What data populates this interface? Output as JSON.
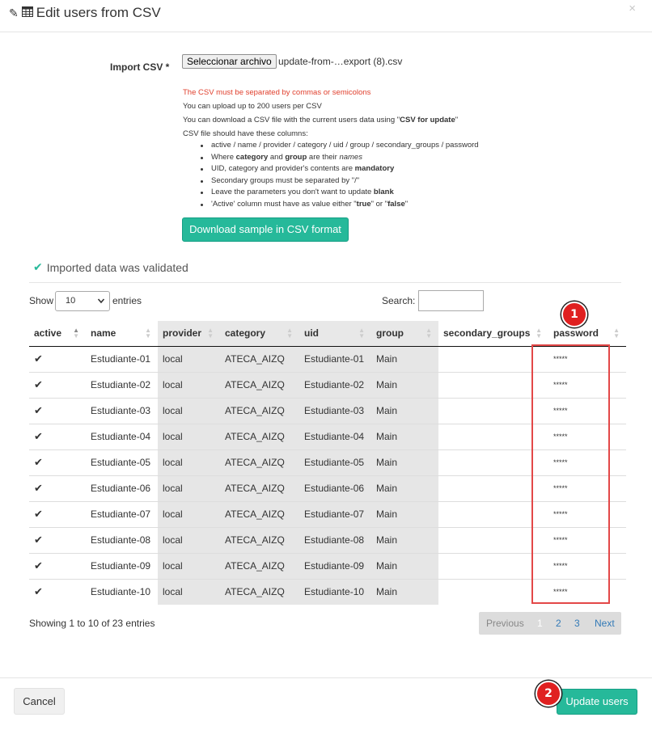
{
  "header": {
    "title": "Edit users from CSV",
    "title_icons": [
      "pencil-icon",
      "table-icon"
    ],
    "close_label": "×"
  },
  "import": {
    "label": "Import CSV *",
    "file_button": "Seleccionar archivo",
    "file_name": "update-from-…export (8).csv",
    "warning": "The CSV must be separated by commas or semicolons",
    "limit": "You can upload up to 200 users per CSV",
    "download_prefix": "You can download a CSV file with the current users data using \"",
    "download_strong": "CSV for update",
    "download_suffix": "\"",
    "columns_intro": "CSV file should have these columns:",
    "bullets": {
      "b1": "active / name / provider / category / uid / group / secondary_groups / password",
      "b2_pre": "Where ",
      "b2_s1": "category",
      "b2_mid": " and ",
      "b2_s2": "group",
      "b2_mid2": " are their ",
      "b2_em": "names",
      "b3_pre": "UID, category and provider's contents are ",
      "b3_strong": "mandatory",
      "b4": "Secondary groups must be separated by \"/\"",
      "b5_pre": "Leave the parameters you don't want to update ",
      "b5_strong": "blank",
      "b6_pre": "'Active' column must have as value either \"",
      "b6_s1": "true",
      "b6_mid": "\" or \"",
      "b6_s2": "false",
      "b6_suf": "\""
    },
    "sample_button": "Download sample in CSV format"
  },
  "validation": {
    "message": "Imported data was validated"
  },
  "table_controls": {
    "show_label": "Show",
    "page_size": "10",
    "entries_label": "entries",
    "search_label": "Search:",
    "search_value": ""
  },
  "table": {
    "headers": {
      "active": "active",
      "name": "name",
      "provider": "provider",
      "category": "category",
      "uid": "uid",
      "group": "group",
      "secondary_groups": "secondary_groups",
      "password": "password"
    },
    "check_glyph": "✔",
    "rows": [
      {
        "name": "Estudiante-01",
        "provider": "local",
        "category": "ATECA_AIZQ",
        "uid": "Estudiante-01",
        "group": "Main",
        "secondary_groups": "",
        "password": "*****"
      },
      {
        "name": "Estudiante-02",
        "provider": "local",
        "category": "ATECA_AIZQ",
        "uid": "Estudiante-02",
        "group": "Main",
        "secondary_groups": "",
        "password": "*****"
      },
      {
        "name": "Estudiante-03",
        "provider": "local",
        "category": "ATECA_AIZQ",
        "uid": "Estudiante-03",
        "group": "Main",
        "secondary_groups": "",
        "password": "*****"
      },
      {
        "name": "Estudiante-04",
        "provider": "local",
        "category": "ATECA_AIZQ",
        "uid": "Estudiante-04",
        "group": "Main",
        "secondary_groups": "",
        "password": "*****"
      },
      {
        "name": "Estudiante-05",
        "provider": "local",
        "category": "ATECA_AIZQ",
        "uid": "Estudiante-05",
        "group": "Main",
        "secondary_groups": "",
        "password": "*****"
      },
      {
        "name": "Estudiante-06",
        "provider": "local",
        "category": "ATECA_AIZQ",
        "uid": "Estudiante-06",
        "group": "Main",
        "secondary_groups": "",
        "password": "*****"
      },
      {
        "name": "Estudiante-07",
        "provider": "local",
        "category": "ATECA_AIZQ",
        "uid": "Estudiante-07",
        "group": "Main",
        "secondary_groups": "",
        "password": "*****"
      },
      {
        "name": "Estudiante-08",
        "provider": "local",
        "category": "ATECA_AIZQ",
        "uid": "Estudiante-08",
        "group": "Main",
        "secondary_groups": "",
        "password": "*****"
      },
      {
        "name": "Estudiante-09",
        "provider": "local",
        "category": "ATECA_AIZQ",
        "uid": "Estudiante-09",
        "group": "Main",
        "secondary_groups": "",
        "password": "*****"
      },
      {
        "name": "Estudiante-10",
        "provider": "local",
        "category": "ATECA_AIZQ",
        "uid": "Estudiante-10",
        "group": "Main",
        "secondary_groups": "",
        "password": "*****"
      }
    ]
  },
  "pagination": {
    "info": "Showing 1 to 10 of 23 entries",
    "previous": "Previous",
    "pages": [
      "1",
      "2",
      "3"
    ],
    "next": "Next"
  },
  "annotations": {
    "badge_1": "1",
    "badge_2": "2"
  },
  "footer": {
    "cancel": "Cancel",
    "update": "Update users"
  },
  "colors": {
    "accent": "#26b99a",
    "warning": "#e0402e",
    "highlight": "#e34848",
    "link": "#337ab7"
  }
}
